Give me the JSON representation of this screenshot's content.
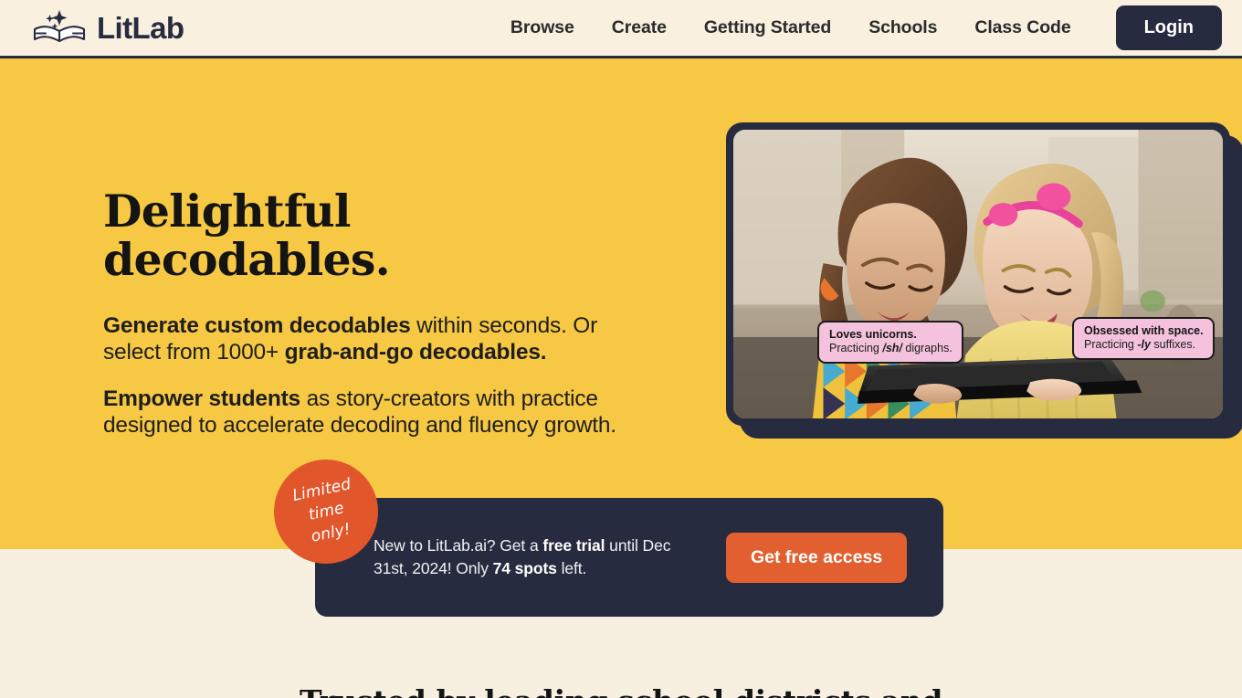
{
  "header": {
    "logo_text": "LitLab",
    "logo_icon": "open-book-sparkles-icon",
    "nav": [
      {
        "label": "Browse"
      },
      {
        "label": "Create"
      },
      {
        "label": "Getting Started"
      },
      {
        "label": "Schools"
      },
      {
        "label": "Class Code"
      }
    ],
    "login_label": "Login"
  },
  "hero": {
    "title": "Delightful decodables.",
    "paragraph1": {
      "bold1": "Generate custom decodables",
      "mid": " within seconds. Or select from 1000+ ",
      "bold2": "grab-and-go decodables."
    },
    "paragraph2": {
      "bold1": "Empower students",
      "rest": " as story-creators with practice designed to accelerate decoding and fluency growth."
    }
  },
  "photo": {
    "alt": "two-girls-reading-on-tablet",
    "tags": [
      {
        "title": "Loves unicorns.",
        "sub_pre": "Practicing ",
        "sub_em": "/sh/",
        "sub_post": " digraphs."
      },
      {
        "title": "Obsessed with space.",
        "sub_pre": "Practicing ",
        "sub_em": "-ly",
        "sub_post": " suffixes."
      }
    ]
  },
  "promo": {
    "badge_line1": "Limited",
    "badge_line2": "time",
    "badge_line3": "only!",
    "text_pre": "New to LitLab.ai? Get a ",
    "text_bold1": "free trial",
    "text_mid": " until Dec 31st, 2024! Only ",
    "text_bold2": "74 spots",
    "text_post": " left.",
    "cta_label": "Get free access"
  },
  "bottom": {
    "heading": "Trusted by leading school districts and"
  },
  "colors": {
    "hero_yellow": "#F7C843",
    "cream": "#F7EFE0",
    "navy": "#272B40",
    "orange": "#E2602F",
    "badge_orange": "#E2562B",
    "tag_pink": "#F4C2DC"
  }
}
